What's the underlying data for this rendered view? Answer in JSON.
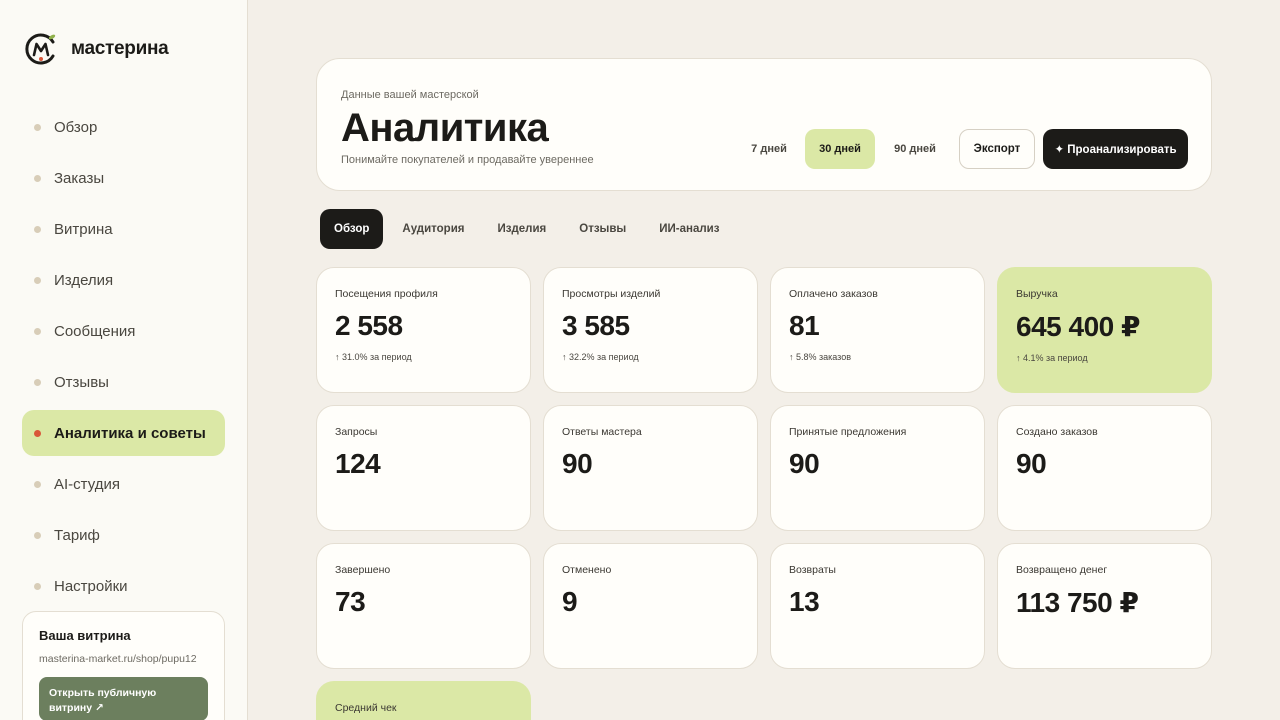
{
  "brand": {
    "name": "мастерина"
  },
  "nav": [
    {
      "label": "Обзор"
    },
    {
      "label": "Заказы"
    },
    {
      "label": "Витрина"
    },
    {
      "label": "Изделия"
    },
    {
      "label": "Сообщения"
    },
    {
      "label": "Отзывы"
    },
    {
      "label": "Аналитика и советы",
      "active": true
    },
    {
      "label": "AI-студия"
    },
    {
      "label": "Тариф"
    },
    {
      "label": "Настройки"
    }
  ],
  "shop": {
    "title": "Ваша витрина",
    "url": "masterina-market.ru/shop/pupu12",
    "open_button": "Открыть публичную витрину ↗"
  },
  "header": {
    "subtitle": "Данные вашей мастерской",
    "title": "Аналитика",
    "description": "Понимайте покупателей и продавайте увереннее",
    "ranges": [
      "7 дней",
      "30 дней",
      "90 дней"
    ],
    "selected_range": "30 дней",
    "export_label": "Экспорт",
    "analyze_label": "✦ Проанализировать"
  },
  "tabs": [
    "Обзор",
    "Аудитория",
    "Изделия",
    "Отзывы",
    "ИИ-анализ"
  ],
  "active_tab": "Обзор",
  "metrics": [
    {
      "label": "Посещения профиля",
      "value": "2 558",
      "delta": "↑ 31.0% за период"
    },
    {
      "label": "Просмотры изделий",
      "value": "3 585",
      "delta": "↑ 32.2% за период"
    },
    {
      "label": "Оплачено заказов",
      "value": "81",
      "delta": "↑ 5.8% заказов"
    },
    {
      "label": "Выручка",
      "value": "645 400 ₽",
      "delta": "↑ 4.1% за период",
      "highlight": true
    },
    {
      "label": "Запросы",
      "value": "124"
    },
    {
      "label": "Ответы мастера",
      "value": "90"
    },
    {
      "label": "Принятые предложения",
      "value": "90"
    },
    {
      "label": "Создано заказов",
      "value": "90"
    },
    {
      "label": "Завершено",
      "value": "73"
    },
    {
      "label": "Отменено",
      "value": "9"
    },
    {
      "label": "Возвраты",
      "value": "13"
    },
    {
      "label": "Возвращено денег",
      "value": "113 750 ₽"
    },
    {
      "label": "Средний чек",
      "value": "",
      "highlight": true
    }
  ],
  "colors": {
    "accent_green": "#dbe8a6",
    "dark": "#1c1b18",
    "active_dot": "#d9573a",
    "shop_button": "#6c7f5e",
    "background": "#f3efe8"
  }
}
